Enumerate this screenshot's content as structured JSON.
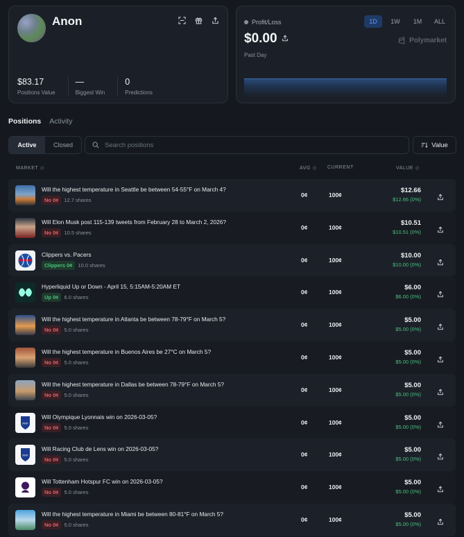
{
  "profile": {
    "username": "Anon",
    "stats": [
      {
        "value": "$83.17",
        "label": "Positions Value"
      },
      {
        "value": "—",
        "label": "Biggest Win"
      },
      {
        "value": "0",
        "label": "Predictions"
      }
    ],
    "icons": [
      "qr-scan-icon",
      "gift-icon",
      "share-icon"
    ]
  },
  "pnl": {
    "label": "Profit/Loss",
    "value": "$0.00",
    "period": "Past Day",
    "ranges": [
      "1D",
      "1W",
      "1M",
      "ALL"
    ],
    "active_range": "1D",
    "brand": "Polymarket"
  },
  "tabs": [
    "Positions",
    "Activity"
  ],
  "filter": {
    "active": "Active",
    "closed": "Closed"
  },
  "search": {
    "placeholder": "Search positions"
  },
  "sort": {
    "label": "Value"
  },
  "columns": {
    "market": "MARKET",
    "avg": "AVG",
    "current": "CURRENT",
    "value": "VALUE"
  },
  "positions": [
    {
      "title": "Will the highest temperature in Seattle be between 54-55°F on March 4?",
      "outcome": "No 0¢",
      "side": "no",
      "shares": "12.7 shares",
      "avg": "0¢",
      "current": "100¢",
      "value": "$12.66",
      "pnl": "$12.66 (0%)",
      "thumb": "city-seattle"
    },
    {
      "title": "Will Elon Musk post 115-139 tweets from February 28 to March 2, 2026?",
      "outcome": "No 0¢",
      "side": "no",
      "shares": "10.5 shares",
      "avg": "0¢",
      "current": "100¢",
      "value": "$10.51",
      "pnl": "$10.51 (0%)",
      "thumb": "person-musk"
    },
    {
      "title": "Clippers vs. Pacers",
      "outcome": "Clippers 0¢",
      "side": "yes",
      "shares": "10.0 shares",
      "avg": "0¢",
      "current": "100¢",
      "value": "$10.00",
      "pnl": "$10.00 (0%)",
      "thumb": "logo-clippers"
    },
    {
      "title": "Hyperliquid Up or Down - April 15, 5:15AM-5:20AM ET",
      "outcome": "Up 0¢",
      "side": "yes",
      "shares": "6.0 shares",
      "avg": "0¢",
      "current": "100¢",
      "value": "$6.00",
      "pnl": "$6.00 (0%)",
      "thumb": "logo-hyperliquid"
    },
    {
      "title": "Will the highest temperature in Atlanta be between 78-79°F on March 5?",
      "outcome": "No 0¢",
      "side": "no",
      "shares": "5.0 shares",
      "avg": "0¢",
      "current": "100¢",
      "value": "$5.00",
      "pnl": "$5.00 (0%)",
      "thumb": "city-atlanta"
    },
    {
      "title": "Will the highest temperature in Buenos Aires be 27°C on March 5?",
      "outcome": "No 0¢",
      "side": "no",
      "shares": "5.0 shares",
      "avg": "0¢",
      "current": "100¢",
      "value": "$5.00",
      "pnl": "$5.00 (0%)",
      "thumb": "city-buenos-aires"
    },
    {
      "title": "Will the highest temperature in Dallas be between 78-79°F on March 5?",
      "outcome": "No 0¢",
      "side": "no",
      "shares": "5.0 shares",
      "avg": "0¢",
      "current": "100¢",
      "value": "$5.00",
      "pnl": "$5.00 (0%)",
      "thumb": "city-dallas"
    },
    {
      "title": "Will Olympique Lyonnais win on 2026-03-05?",
      "outcome": "No 0¢",
      "side": "no",
      "shares": "5.0 shares",
      "avg": "0¢",
      "current": "100¢",
      "value": "$5.00",
      "pnl": "$5.00 (0%)",
      "thumb": "logo-fff"
    },
    {
      "title": "Will Racing Club de Lens win on 2026-03-05?",
      "outcome": "No 0¢",
      "side": "no",
      "shares": "5.0 shares",
      "avg": "0¢",
      "current": "100¢",
      "value": "$5.00",
      "pnl": "$5.00 (0%)",
      "thumb": "logo-fff"
    },
    {
      "title": "Will Tottenham Hotspur FC win on 2026-03-05?",
      "outcome": "No 0¢",
      "side": "no",
      "shares": "5.0 shares",
      "avg": "0¢",
      "current": "100¢",
      "value": "$5.00",
      "pnl": "$5.00 (0%)",
      "thumb": "logo-premier-league"
    },
    {
      "title": "Will the highest temperature in Miami be between 80-81°F on March 5?",
      "outcome": "No 0¢",
      "side": "no",
      "shares": "5.0 shares",
      "avg": "0¢",
      "current": "100¢",
      "value": "$5.00",
      "pnl": "$5.00 (0%)",
      "thumb": "city-miami"
    }
  ],
  "colors": {
    "accent": "#5b9bf8",
    "positive": "#4ac07f",
    "negative": "#e0606a",
    "background": "#15191f"
  }
}
